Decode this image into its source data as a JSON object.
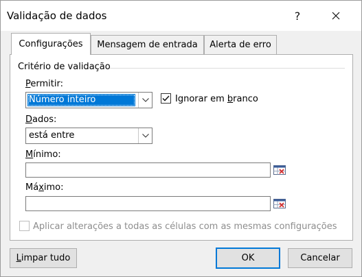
{
  "window": {
    "title": "Validação de dados",
    "help_glyph": "?",
    "close_glyph": "✕"
  },
  "tabs": [
    {
      "label": "Configurações",
      "active": true
    },
    {
      "label": "Mensagem de entrada",
      "active": false
    },
    {
      "label": "Alerta de erro",
      "active": false
    }
  ],
  "criteria": {
    "group_label": "Critério de validação",
    "allow_label_mnemonic": "P",
    "allow_label_rest": "ermitir:",
    "allow_value": "Número inteiro",
    "ignore_blank": {
      "pre": "Ignorar em ",
      "mnemonic": "b",
      "post": "ranco",
      "checked": true
    },
    "data_label_mnemonic": "D",
    "data_label_rest": "ados:",
    "data_value": "está entre",
    "min_label_mnemonic": "M",
    "min_label_rest": "ínimo:",
    "min_value": "",
    "max_label_pre": "Má",
    "max_label_mnemonic": "x",
    "max_label_rest": "imo:",
    "max_value": ""
  },
  "apply_all": {
    "label": "Aplicar alterações a todas as células com as mesmas configurações",
    "checked": false,
    "enabled": false
  },
  "buttons": {
    "clear_mnemonic": "L",
    "clear_rest": "impar tudo",
    "ok": "OK",
    "cancel": "Cancelar"
  },
  "colors": {
    "accent": "#0078d7",
    "dialog_bg": "#f0f0f0",
    "panel_bg": "#ffffff"
  }
}
